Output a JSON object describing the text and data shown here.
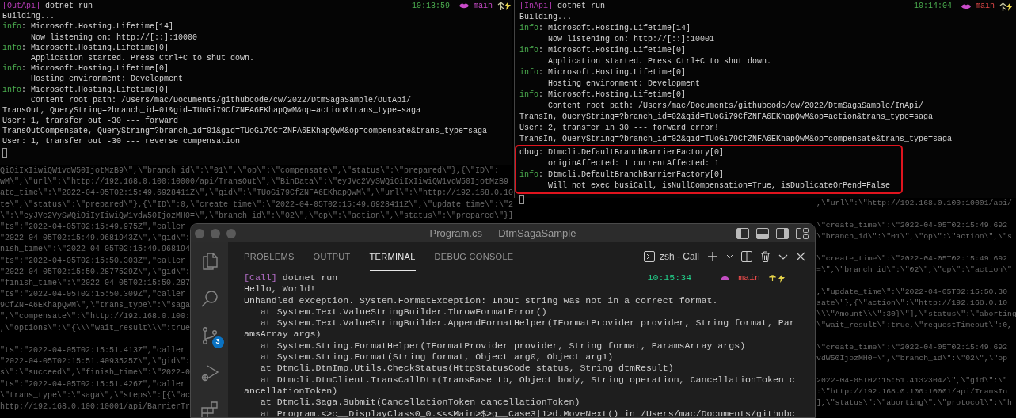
{
  "background_log": {
    "left_lines": [
      {
        "kind": "text",
        "text": "QiOiIxIiwiQW1vdW50IjotMzB9\\\",\\\"branch_id\\\":\\\"01\\\",\\\"op\\\":\\\"compensate\\\",\\\"status\\\":\\\"prepared\\\"},{\\\"ID\\\":"
      },
      {
        "kind": "text",
        "text": "wM\\\",\\\"url\\\":\\\"http://192.168.0.100:10000/api/TransOut\\\",\\\"BinData\\\":\\\"eyJVc2VySWQiOiIxIiwiQW1vdW50IjotMzB9"
      },
      {
        "kind": "text",
        "text": "ate_time\\\":\\\"2022-04-05T02:15:49.6928411Z\\\",\\\"gid\\\":\\\"TUoGi79CfZNFA6EKhapQwM\\\",\\\"url\\\":\\\"http://192.168.0.10"
      },
      {
        "kind": "text",
        "text": "te\\\",\\\"status\\\":\\\"prepared\\\"},{\\\"ID\\\":0,\\\"create_time\\\":\\\"2022-04-05T02:15:49.6928411Z\\\",\\\"update_time\\\":\\\"2"
      },
      {
        "kind": "text",
        "text": "\\\":\\\"eyJVc2VySWQiOiIyIiwiQW1vdW50IjozMH0=\\\",\\\"branch_id\\\":\\\"02\\\",\\\"op\\\":\\\"action\\\",\\\"status\\\":\\\"prepared\\\"}]"
      },
      {
        "kind": "text",
        "text": "\"ts\":\"2022-04-05T02:15:49.975Z\",\"caller"
      },
      {
        "kind": "text",
        "text": "\"2022-04-05T02:15:49.9681943Z\\\",\\\"gid\\\":"
      },
      {
        "kind": "text",
        "text": "nish_time\\\":\\\"2022-04-05T02:15:49.968194"
      },
      {
        "kind": "text",
        "text": "\"ts\":\"2022-04-05T02:15:50.303Z\",\"caller"
      },
      {
        "kind": "text",
        "text": "\"2022-04-05T02:15:50.2877529Z\\\",\\\"gid\\\":"
      },
      {
        "kind": "text",
        "text": "\"finish_time\\\":\\\"2022-04-05T02:15:50.287"
      },
      {
        "kind": "text",
        "text": "\"ts\":\"2022-04-05T02:15:50.309Z\",\"caller"
      },
      {
        "kind": "text",
        "text": "9CfZNFA6EKhapQwM\\\",\\\"trans_type\\\":\\\"saga"
      },
      {
        "kind": "text",
        "text": "\",\\\"compensate\\\":\\\"http://192.168.0.100:"
      },
      {
        "kind": "text",
        "text": ",\\\"options\\\":\\\"{\\\\\\\"wait_result\\\\\\\":true"
      },
      {
        "kind": "blank"
      },
      {
        "kind": "text",
        "text": "\"ts\":\"2022-04-05T02:15:51.413Z\",\"caller"
      },
      {
        "kind": "text",
        "text": "\"2022-04-05T02:15:51.4093525Z\\\",\\\"gid\\\":"
      },
      {
        "kind": "text",
        "text": "s\\\":\\\"succeed\\\",\\\"finish_time\\\":\\\"2022-0"
      },
      {
        "kind": "text",
        "text": "\"ts\":\"2022-04-05T02:15:51.426Z\",\"caller"
      },
      {
        "kind": "text",
        "text": "\\\"trans_type\\\":\\\"saga\\\",\\\"steps\\\":[{\\\"ac"
      },
      {
        "kind": "text",
        "text": "http://192.168.0.100:10001/api/BarrierTr"
      }
    ],
    "right_lines": [
      {
        "kind": "text",
        "text": ",\\\"url\\\":\\\"http://192.168.0.100:10001/api/"
      },
      {
        "kind": "blank"
      },
      {
        "kind": "text",
        "text": "\\\"create_time\\\":\\\"2022-04-05T02:15:49.692"
      },
      {
        "kind": "text",
        "text": "\\\"branch_id\\\":\\\"01\\\",\\\"op\\\":\\\"action\\\",\\\"s"
      },
      {
        "kind": "blank"
      },
      {
        "kind": "text",
        "text": "\\\"create_time\\\":\\\"2022-04-05T02:15:49.692"
      },
      {
        "kind": "text",
        "text": "=\\\",\\\"branch_id\\\":\\\"02\\\",\\\"op\\\":\\\"action\\\""
      },
      {
        "kind": "blank"
      },
      {
        "kind": "text",
        "text": ",\\\"update_time\\\":\\\"2022-04-05T02:15:50.30"
      },
      {
        "kind": "text",
        "text": "sate\\\"},{\\\"action\\\":\\\"http://192.168.0.10"
      },
      {
        "kind": "text",
        "text": "\\\\\\\"Amount\\\\\\\":30}\\\"],\\\"status\\\":\\\"aborting"
      },
      {
        "kind": "text",
        "text": "\\\"wait_result\\\":true,\\\"requestTimeout\\\":0,"
      },
      {
        "kind": "blank"
      },
      {
        "kind": "text",
        "text": "\\\"create_time\\\":\\\"2022-04-05T02:15:49.692"
      },
      {
        "kind": "text",
        "text": "vdW50IjozMH0=\\\",\\\"branch_id\\\":\\\"02\\\",\\\"op"
      },
      {
        "kind": "blank"
      },
      {
        "kind": "text",
        "text": "2022-04-05T02:15:51.4132304Z\\\",\\\"gid\\\":\\\""
      },
      {
        "kind": "text",
        "text": ":\\\"http://192.168.0.100:10001/api/TransIn"
      },
      {
        "kind": "text",
        "text": "],\\\"status\\\":\\\"aborting\\\",\\\"protocol\\\":\\\"h"
      }
    ]
  },
  "terminals": [
    {
      "lines": [
        {
          "kind": "prompt",
          "tag": "[OutApi]",
          "command": "dotnet run",
          "time": "10:13:59",
          "branch": "main"
        },
        {
          "kind": "plain",
          "text": "Building..."
        },
        {
          "kind": "log",
          "level": "info",
          "text": ": Microsoft.Hosting.Lifetime[14]"
        },
        {
          "kind": "detail",
          "text": "Now listening on: http://[::]:10000"
        },
        {
          "kind": "log",
          "level": "info",
          "text": ": Microsoft.Hosting.Lifetime[0]"
        },
        {
          "kind": "detail",
          "text": "Application started. Press Ctrl+C to shut down."
        },
        {
          "kind": "log",
          "level": "info",
          "text": ": Microsoft.Hosting.Lifetime[0]"
        },
        {
          "kind": "detail",
          "text": "Hosting environment: Development"
        },
        {
          "kind": "log",
          "level": "info",
          "text": ": Microsoft.Hosting.Lifetime[0]"
        },
        {
          "kind": "detail",
          "text": "Content root path: /Users/mac/Documents/githubcode/cw/2022/DtmSagaSample/OutApi/"
        },
        {
          "kind": "plain",
          "text": "TransOut, QueryString=?branch_id=01&gid=TUoGi79CfZNFA6EKhapQwM&op=action&trans_type=saga"
        },
        {
          "kind": "plain",
          "text": "User: 1, transfer out -30 --- forward"
        },
        {
          "kind": "plain",
          "text": "TransOutCompensate, QueryString=?branch_id=01&gid=TUoGi79CfZNFA6EKhapQwM&op=compensate&trans_type=saga"
        },
        {
          "kind": "plain",
          "text": "User: 1, transfer out -30 --- reverse compensation"
        }
      ]
    },
    {
      "lines": [
        {
          "kind": "prompt",
          "tag": "[InApi]",
          "command": "dotnet run",
          "time": "10:14:04",
          "branch": "main"
        },
        {
          "kind": "plain",
          "text": "Building..."
        },
        {
          "kind": "log",
          "level": "info",
          "text": ": Microsoft.Hosting.Lifetime[14]"
        },
        {
          "kind": "detail",
          "text": "Now listening on: http://[::]:10001"
        },
        {
          "kind": "log",
          "level": "info",
          "text": ": Microsoft.Hosting.Lifetime[0]"
        },
        {
          "kind": "detail",
          "text": "Application started. Press Ctrl+C to shut down."
        },
        {
          "kind": "log",
          "level": "info",
          "text": ": Microsoft.Hosting.Lifetime[0]"
        },
        {
          "kind": "detail",
          "text": "Hosting environment: Development"
        },
        {
          "kind": "log",
          "level": "info",
          "text": ": Microsoft.Hosting.Lifetime[0]"
        },
        {
          "kind": "detail",
          "text": "Content root path: /Users/mac/Documents/githubcode/cw/2022/DtmSagaSample/InApi/"
        },
        {
          "kind": "plain",
          "text": "TransIn, QueryString=?branch_id=02&gid=TUoGi79CfZNFA6EKhapQwM&op=action&trans_type=saga"
        },
        {
          "kind": "plain",
          "text": "User: 2, transfer in 30 --- forward error!"
        },
        {
          "kind": "plain",
          "text": "TransIn, QueryString=?branch_id=02&gid=TUoGi79CfZNFA6EKhapQwM&op=compensate&trans_type=saga"
        },
        {
          "kind": "group",
          "highlighted": true,
          "lines": [
            {
              "kind": "log",
              "level": "dbug",
              "text": ": Dtmcli.DefaultBranchBarrierFactory[0]"
            },
            {
              "kind": "detail",
              "text": "originAffected: 1 currentAffected: 1"
            },
            {
              "kind": "log",
              "level": "info",
              "text": ": Dtmcli.DefaultBranchBarrierFactory[0]"
            },
            {
              "kind": "detail",
              "text": "Will not exec busiCall, isNullCompensation=True, isDuplicateOrPend=False"
            }
          ]
        }
      ]
    }
  ],
  "editor": {
    "title": "Program.cs — DtmSagaSample",
    "activity_bar": [
      {
        "kind": "files"
      },
      {
        "kind": "search"
      },
      {
        "kind": "source-control",
        "badge": "3"
      },
      {
        "kind": "run-debug"
      },
      {
        "kind": "extensions"
      }
    ],
    "panel_tabs": [
      {
        "label": "PROBLEMS",
        "selected": false
      },
      {
        "label": "OUTPUT",
        "selected": false
      },
      {
        "label": "TERMINAL",
        "selected": true
      },
      {
        "label": "DEBUG CONSOLE",
        "selected": false
      }
    ],
    "terminal_name": "zsh - Call",
    "terminal_lines": [
      {
        "kind": "prompt",
        "tag": "[Call]",
        "command": "dotnet run",
        "time": "10:15:34",
        "branch": "main"
      },
      {
        "kind": "plain",
        "text": "Hello, World!"
      },
      {
        "kind": "plain",
        "text": "Unhandled exception. System.FormatException: Input string was not in a correct format."
      },
      {
        "kind": "frame",
        "text": "at System.Text.ValueStringBuilder.ThrowFormatError()"
      },
      {
        "kind": "frame",
        "text": "at System.Text.ValueStringBuilder.AppendFormatHelper(IFormatProvider provider, String format, Par"
      },
      {
        "kind": "plain",
        "text": "amsArray args)"
      },
      {
        "kind": "frame",
        "text": "at System.String.FormatHelper(IFormatProvider provider, String format, ParamsArray args)"
      },
      {
        "kind": "frame",
        "text": "at System.String.Format(String format, Object arg0, Object arg1)"
      },
      {
        "kind": "frame",
        "text": "at Dtmcli.DtmImp.Utils.CheckStatus(HttpStatusCode status, String dtmResult)"
      },
      {
        "kind": "frame",
        "text": "at Dtmcli.DtmClient.TransCallDtm(TransBase tb, Object body, String operation, CancellationToken c"
      },
      {
        "kind": "plain",
        "text": "ancellationToken)"
      },
      {
        "kind": "frame",
        "text": "at Dtmcli.Saga.Submit(CancellationToken cancellationToken)"
      },
      {
        "kind": "frame",
        "text": "at Program.<>c__DisplayClass0_0.<<<Main>$>g__Case3|1>d.MoveNext() in /Users/mac/Documents/githubc"
      }
    ]
  }
}
